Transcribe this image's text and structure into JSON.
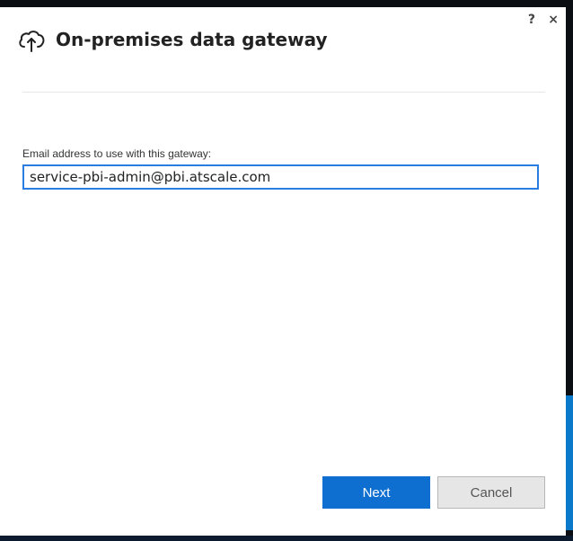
{
  "dialog": {
    "title": "On-premises data gateway",
    "help_label": "?",
    "close_label": "×"
  },
  "form": {
    "email_label": "Email address to use with this gateway:",
    "email_value": "service-pbi-admin@pbi.atscale.com"
  },
  "buttons": {
    "next_label": "Next",
    "cancel_label": "Cancel"
  },
  "icons": {
    "title_icon": "cloud-upload-icon"
  },
  "colors": {
    "accent": "#0f6fd1",
    "input_border": "#2a7de1",
    "cancel_bg": "#e6e6e6"
  }
}
